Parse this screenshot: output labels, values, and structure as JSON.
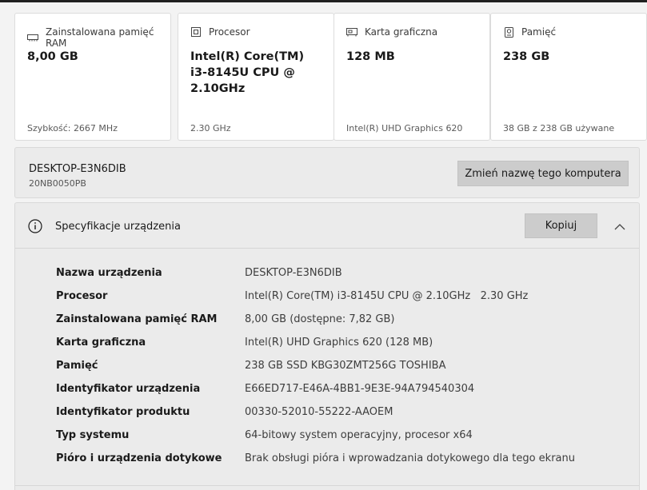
{
  "cards": [
    {
      "icon": "ram-icon",
      "label": "Zainstalowana pamięć RAM",
      "value": "8,00 GB",
      "sub": "Szybkość: 2667 MHz"
    },
    {
      "icon": "processor-icon",
      "label": "Procesor",
      "value": "Intel(R) Core(TM) i3-8145U CPU @ 2.10GHz",
      "sub": "2.30 GHz"
    },
    {
      "icon": "graphics-card-icon",
      "label": "Karta graficzna",
      "value": "128 MB",
      "sub": "Intel(R) UHD Graphics 620"
    },
    {
      "icon": "storage-icon",
      "label": "Pamięć",
      "value": "238 GB",
      "sub": "38 GB z 238 GB używane"
    }
  ],
  "device": {
    "name": "DESKTOP-E3N6DIB",
    "model": "20NB0050PB",
    "rename_label": "Zmień nazwę tego komputera"
  },
  "specs": {
    "title": "Specyfikacje urządzenia",
    "copy_label": "Kopiuj",
    "rows": [
      {
        "label": "Nazwa urządzenia",
        "value": "DESKTOP-E3N6DIB"
      },
      {
        "label": "Procesor",
        "value": "Intel(R) Core(TM) i3-8145U CPU @ 2.10GHz   2.30 GHz"
      },
      {
        "label": "Zainstalowana pamięć RAM",
        "value": "8,00 GB (dostępne: 7,82 GB)"
      },
      {
        "label": "Karta graficzna",
        "value": "Intel(R) UHD Graphics 620 (128 MB)"
      },
      {
        "label": "Pamięć",
        "value": "238 GB SSD KBG30ZMT256G TOSHIBA"
      },
      {
        "label": "Identyfikator urządzenia",
        "value": "E66ED717-E46A-4BB1-9E3E-94A794540304"
      },
      {
        "label": "Identyfikator produktu",
        "value": "00330-52010-55222-AAOEM"
      },
      {
        "label": "Typ systemu",
        "value": "64-bitowy system operacyjny, procesor x64"
      },
      {
        "label": "Pióro i urządzenia dotykowe",
        "value": "Brak obsługi pióra i wprowadzania dotykowego dla tego ekranu"
      }
    ]
  }
}
